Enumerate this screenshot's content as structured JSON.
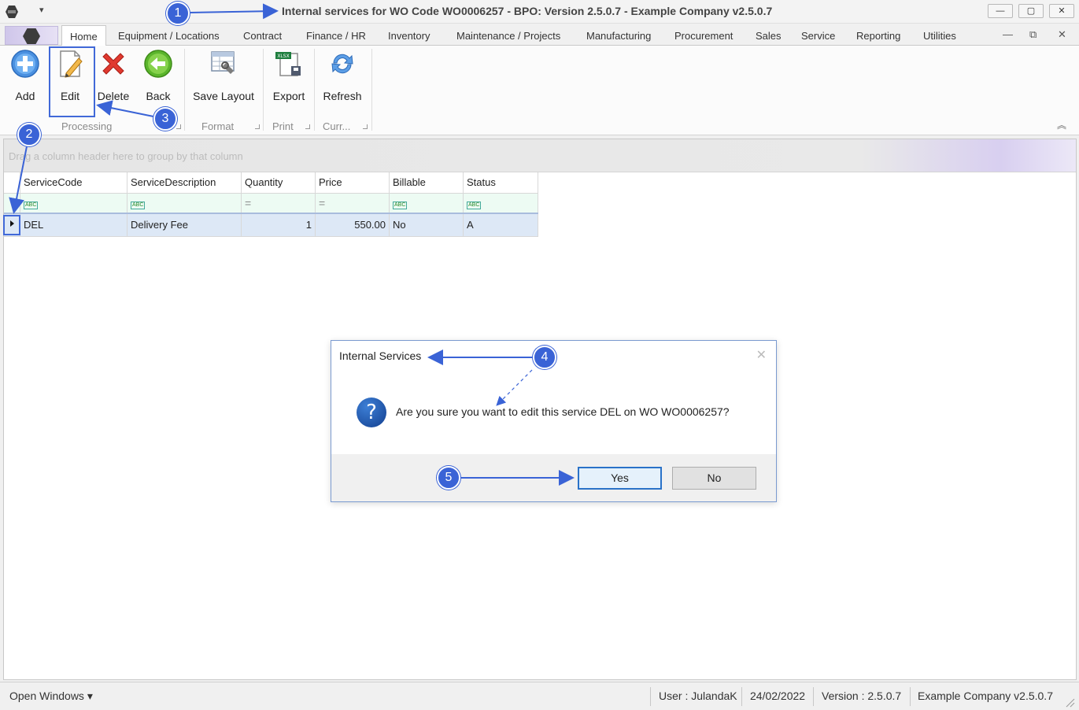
{
  "window": {
    "title": "Internal services for WO Code WO0006257 - BPO: Version 2.5.0.7 - Example Company v2.5.0.7",
    "minimize_glyph": "—",
    "maximize_glyph": "▢",
    "close_glyph": "✕",
    "quick_access_glyph": "▾"
  },
  "menu": {
    "tabs": [
      "Home",
      "Equipment / Locations",
      "Contract",
      "Finance / HR",
      "Inventory",
      "Maintenance / Projects",
      "Manufacturing",
      "Procurement",
      "Sales",
      "Service",
      "Reporting",
      "Utilities"
    ],
    "active_tab": "Home",
    "mdi_min_glyph": "—",
    "mdi_restore_glyph": "⧉",
    "mdi_close_glyph": "✕"
  },
  "ribbon": {
    "buttons": {
      "add": "Add",
      "edit": "Edit",
      "delete": "Delete",
      "back": "Back",
      "save_layout": "Save Layout",
      "export": "Export",
      "refresh": "Refresh"
    },
    "groups": {
      "processing": "Processing",
      "format": "Format",
      "print": "Print",
      "current": "Curr..."
    },
    "export_badge": "XLSX",
    "collapse_glyph": "︽"
  },
  "grid": {
    "group_panel_text": "Drag a column header here to group by that column",
    "columns": [
      "ServiceCode",
      "ServiceDescription",
      "Quantity",
      "Price",
      "Billable",
      "Status"
    ],
    "filter_abc": "ABC",
    "filter_eq": "=",
    "rows": [
      {
        "service_code": "DEL",
        "service_description": "Delivery Fee",
        "quantity": "1",
        "price": "550.00",
        "billable": "No",
        "status": "A"
      }
    ]
  },
  "dialog": {
    "title": "Internal Services",
    "message": "Are you sure you want to edit this service DEL on WO WO0006257?",
    "question_glyph": "?",
    "close_glyph": "✕",
    "yes_label": "Yes",
    "no_label": "No"
  },
  "status_bar": {
    "open_windows": "Open Windows ▾",
    "user": "User : JulandaK",
    "date": "24/02/2022",
    "version": "Version : 2.5.0.7",
    "company": "Example Company v2.5.0.7"
  },
  "annotations": [
    "1",
    "2",
    "3",
    "4",
    "5"
  ],
  "colors": {
    "annotation_blue": "#3a63d6",
    "dialog_default_border": "#2a72c8",
    "selected_row": "#dde8f6",
    "filter_row": "#edfbf3"
  }
}
